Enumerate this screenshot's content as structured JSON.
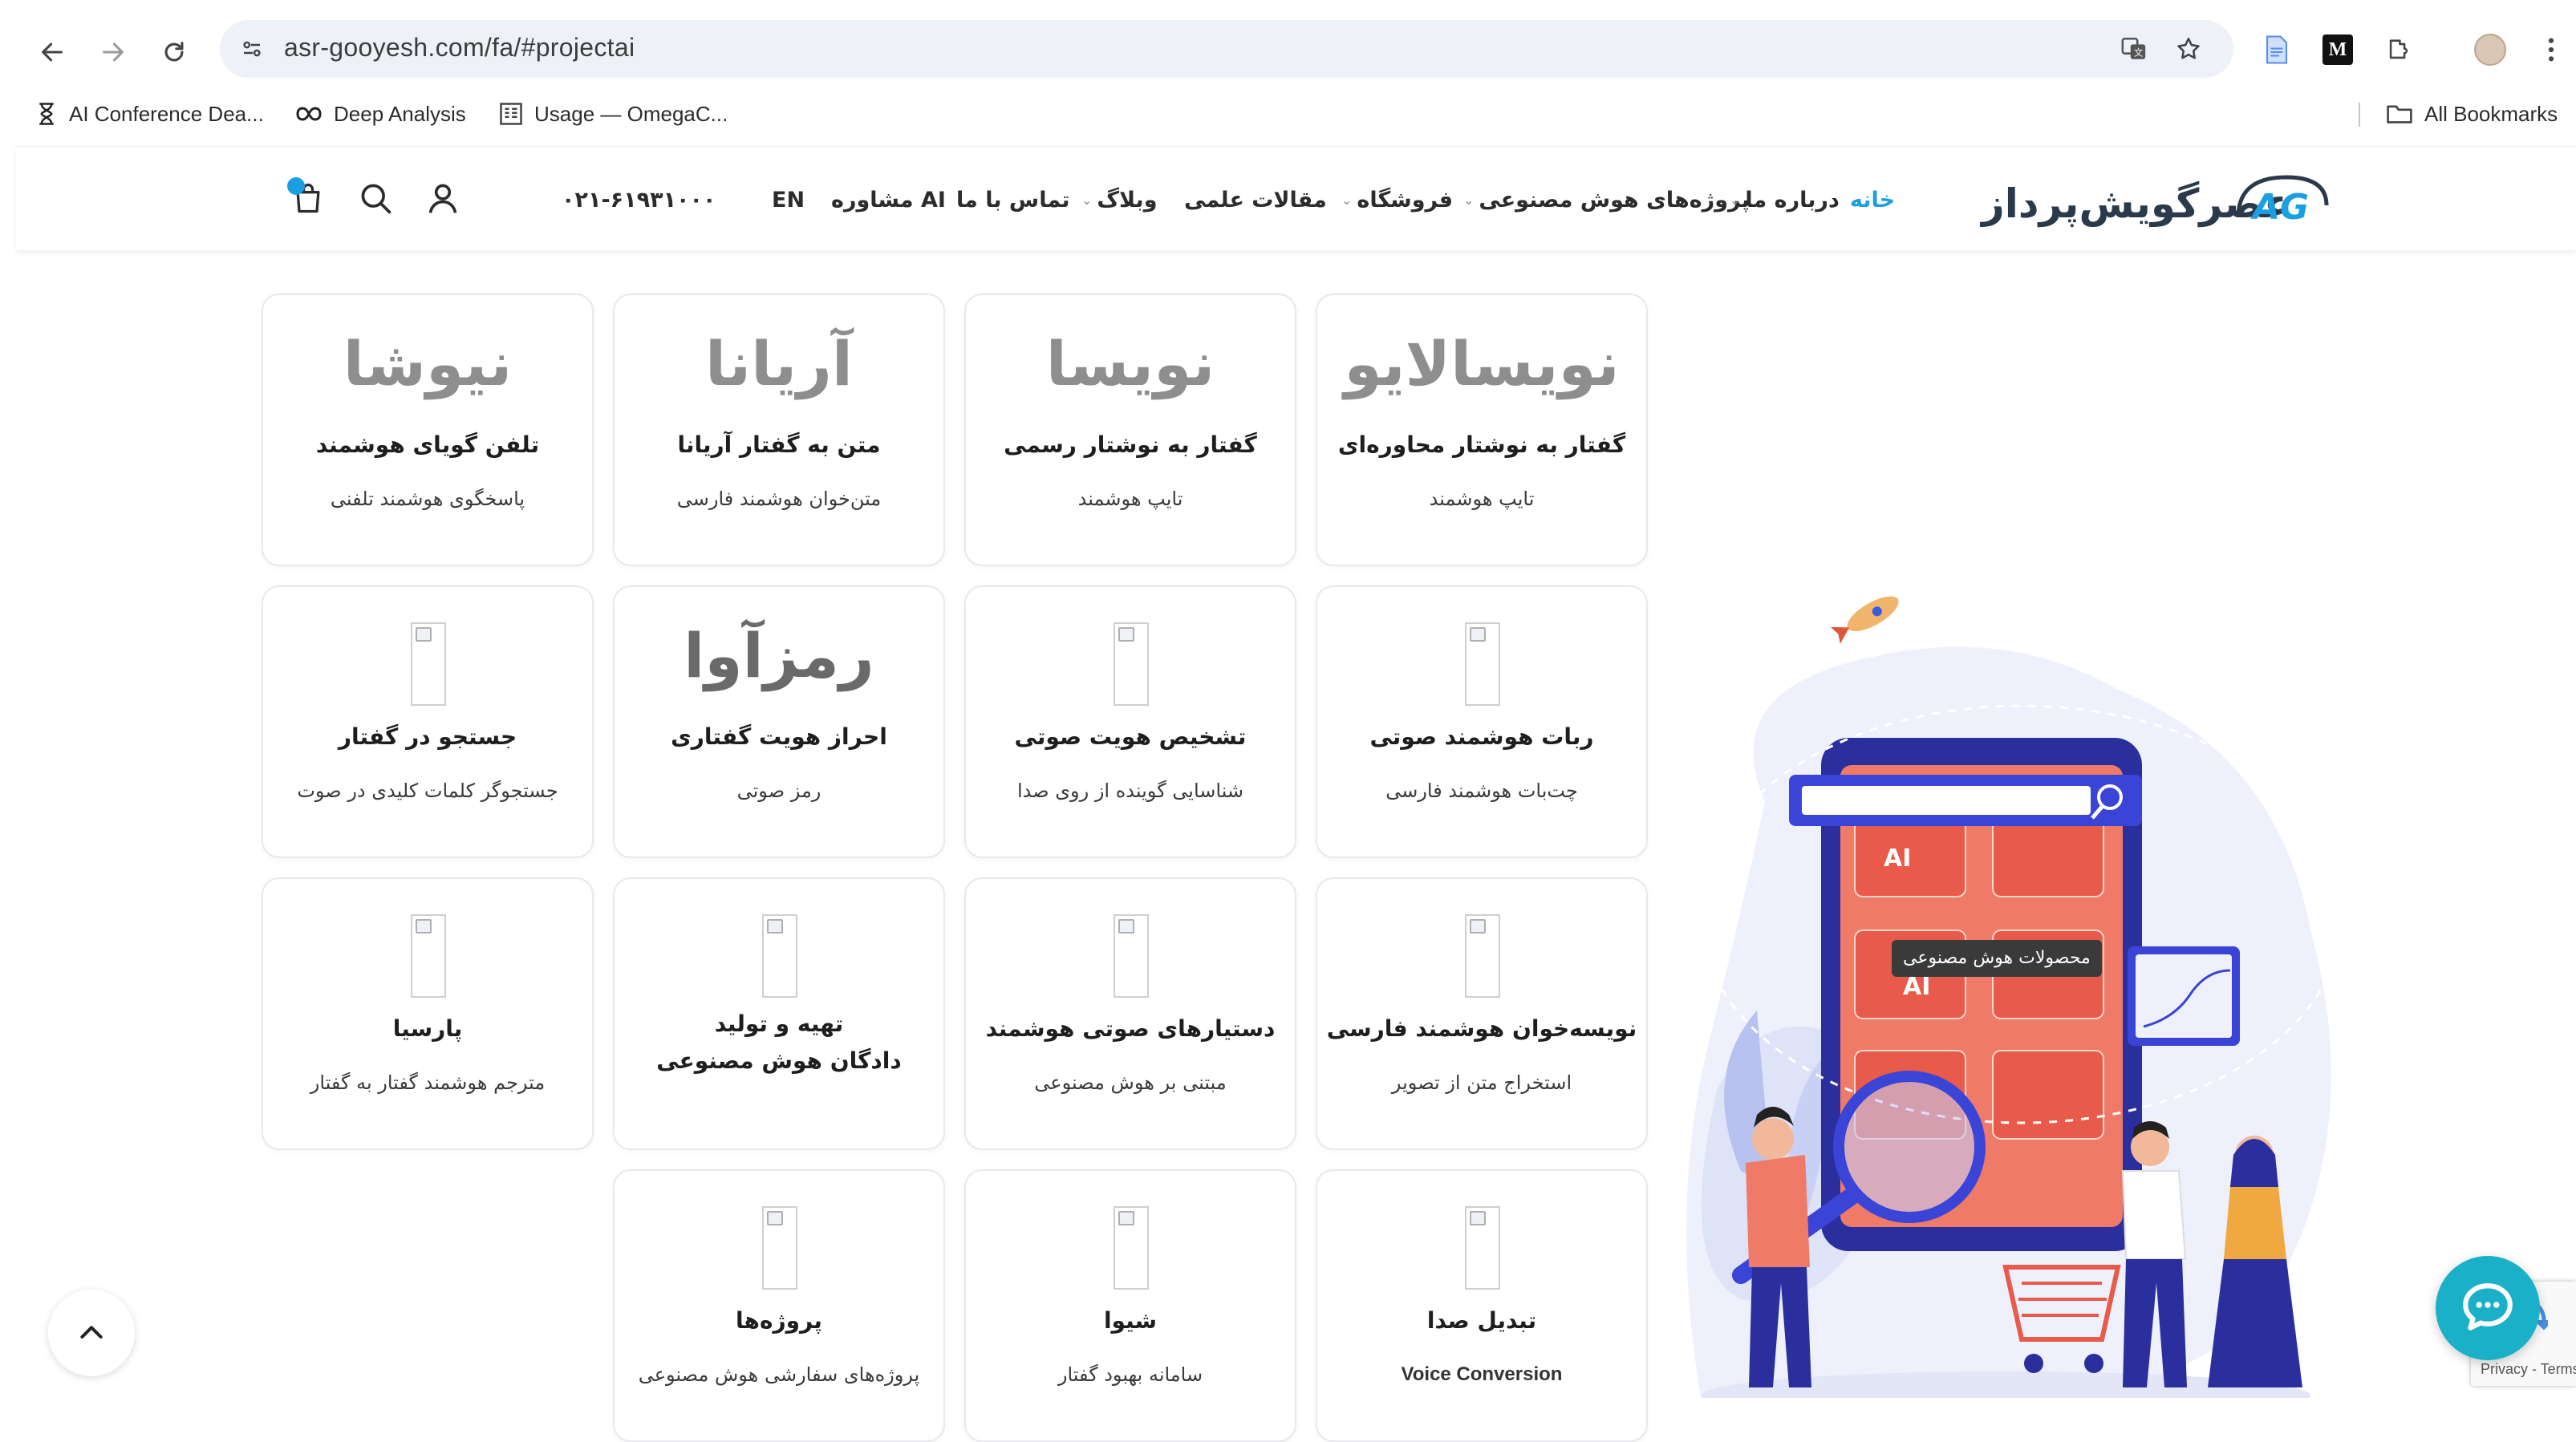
{
  "browser": {
    "url": "asr-gooyesh.com/fa/#projectai",
    "bookmarks": [
      {
        "label": "AI Conference Dea...",
        "icon": "hourglass-icon"
      },
      {
        "label": "Deep Analysis",
        "icon": "infinity-icon"
      },
      {
        "label": "Usage — OmegaC...",
        "icon": "document-icon"
      }
    ],
    "all_bookmarks": "All Bookmarks"
  },
  "header": {
    "logo_text": "عصرگویش‌پرداز",
    "logo_mark": "AG",
    "menu": [
      {
        "label": "خانه",
        "active": true,
        "dropdown": false
      },
      {
        "label": "درباره ما",
        "active": false,
        "dropdown": true
      },
      {
        "label": "پروژه‌های هوش مصنوعی",
        "active": false,
        "dropdown": true
      },
      {
        "label": "فروشگاه",
        "active": false,
        "dropdown": true
      },
      {
        "label": "مقالات علمی",
        "active": false,
        "dropdown": false
      },
      {
        "label": "وبلاگ",
        "active": false,
        "dropdown": true
      },
      {
        "label": "تماس با ما",
        "active": false,
        "dropdown": false
      },
      {
        "label": "مشاوره AI",
        "active": false,
        "dropdown": false
      },
      {
        "label": "EN",
        "active": false,
        "dropdown": false
      }
    ],
    "phone": "۰۲۱-۶۱۹۳۱۰۰۰"
  },
  "cards": [
    {
      "brand": "نویسالایو",
      "title": "گفتار به نوشتار محاوره‌ای",
      "sub": "تایپ هوشمند"
    },
    {
      "brand": "نویسا",
      "title": "گفتار به نوشتار رسمی",
      "sub": "تایپ هوشمند"
    },
    {
      "brand": "آریانا",
      "title": "متن به گفتار آریانا",
      "sub": "متن‌خوان هوشمند فارسی"
    },
    {
      "brand": "نیوشا",
      "title": "تلفن گویای هوشمند",
      "sub": "پاسخگوی هوشمند تلفنی"
    },
    {
      "brand": "",
      "title": "ربات هوشمند صوتی",
      "sub": "چت‌بات هوشمند فارسی"
    },
    {
      "brand": "",
      "title": "تشخیص هویت صوتی",
      "sub": "شناسایی گوینده از روی صدا"
    },
    {
      "brand": "رمزآوا",
      "title": "احراز هویت گفتاری",
      "sub": "رمز صوتی"
    },
    {
      "brand": "",
      "title": "جستجو در گفتار",
      "sub": "جستجوگر کلمات کلیدی در صوت"
    },
    {
      "brand": "",
      "title": "نویسه‌خوان هوشمند فارسی",
      "sub": "استخراج متن از تصویر"
    },
    {
      "brand": "",
      "title": "دستیارهای صوتی هوشمند",
      "sub": "مبتنی بر هوش مصنوعی"
    },
    {
      "brand": "",
      "title": "تهیه و تولید",
      "title2": "دادگان هوش مصنوعی",
      "sub": ""
    },
    {
      "brand": "",
      "title": "پارسیا",
      "sub": "مترجم هوشمند گفتار به گفتار"
    },
    {
      "brand": "",
      "title": "تبدیل صدا",
      "sub": "Voice Conversion"
    },
    {
      "brand": "",
      "title": "شیوا",
      "sub": "سامانه بهبود گفتار"
    },
    {
      "brand": "",
      "title": "پروژه‌ها",
      "sub": "پروژه‌های سفارشی هوش مصنوعی"
    }
  ],
  "illustration": {
    "tooltip": "محصولات هوش مصنوعی",
    "tile_label_ai": "AI"
  },
  "recaptcha": {
    "text": "Privacy - Terms"
  },
  "colors": {
    "accent": "#1aa0e0",
    "chat": "#1ab0c8",
    "phone_screen": "#f07a68"
  }
}
